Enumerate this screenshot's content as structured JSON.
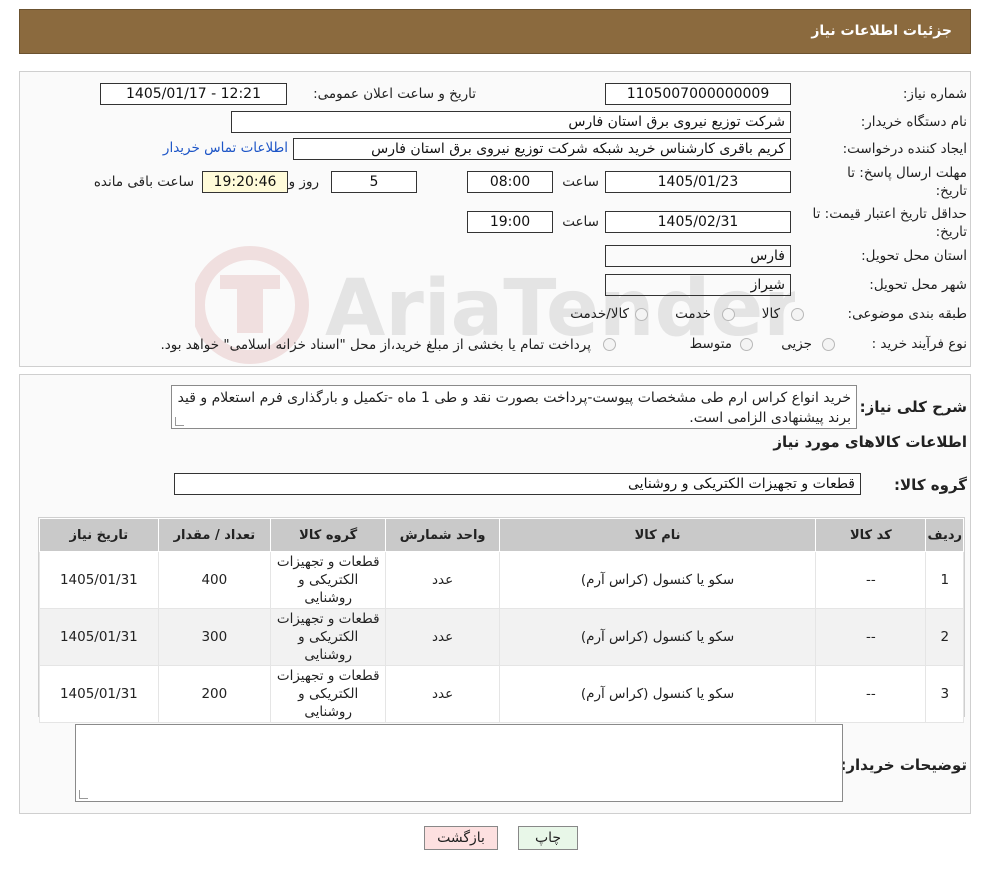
{
  "header": {
    "title": "جزئیات اطلاعات نیاز"
  },
  "form": {
    "need_number_label": "شماره نیاز:",
    "need_number": "1105007000000009",
    "announce_label": "تاریخ و ساعت اعلان عمومی:",
    "announce_value": "1405/01/17 - 12:21",
    "buyer_org_label": "نام دستگاه خریدار:",
    "buyer_org": "شرکت توزیع نیروی برق استان فارس",
    "creator_label": "ایجاد کننده درخواست:",
    "creator": "کریم باقری کارشناس خرید شبکه شرکت توزیع نیروی برق استان فارس",
    "contact_link": "اطلاعات تماس خریدار",
    "deadline_label_1": "مهلت ارسال پاسخ: تا",
    "deadline_label_2": "تاریخ:",
    "deadline_date": "1405/01/23",
    "time_label": "ساعت",
    "deadline_time": "08:00",
    "days_value": "5",
    "days_label": "روز و",
    "remaining_time": "19:20:46",
    "remaining_label": "ساعت باقی مانده",
    "validity_label_1": "حداقل تاریخ اعتبار قیمت: تا",
    "validity_label_2": "تاریخ:",
    "validity_date": "1405/02/31",
    "validity_time": "19:00",
    "province_label": "استان محل تحویل:",
    "province": "فارس",
    "city_label": "شهر محل تحویل:",
    "city": "شیراز",
    "category_label": "طبقه بندی موضوعی:",
    "category_options": [
      "کالا",
      "خدمت",
      "کالا/خدمت"
    ],
    "process_label": "نوع فرآیند خرید :",
    "process_options": [
      "جزیی",
      "متوسط"
    ],
    "process_note": "پرداخت تمام یا بخشی از مبلغ خرید،از محل \"اسناد خزانه اسلامی\" خواهد بود."
  },
  "watermark": {
    "text": "AriaTender.neT"
  },
  "description": {
    "label": "شرح کلی نیاز:",
    "text": "خرید انواع کراس ارم طی مشخصات پیوست-پرداخت بصورت نقد و طی 1 ماه -تکمیل و بارگذاری فرم استعلام و قید برند پیشنهادی الزامی است."
  },
  "goods_section": {
    "title": "اطلاعات کالاهای مورد نیاز",
    "group_label": "گروه کالا:",
    "group_value": "قطعات و تجهیزات الکتریکی و روشنایی"
  },
  "table": {
    "headers": [
      "ردیف",
      "کد کالا",
      "نام کالا",
      "واحد شمارش",
      "گروه کالا",
      "تعداد / مقدار",
      "تاریخ نیاز"
    ],
    "rows": [
      {
        "index": "1",
        "code": "--",
        "name": "سکو یا کنسول (کراس آرم)",
        "unit": "عدد",
        "group": [
          "قطعات و تجهیزات",
          "الکتریکی و",
          "روشنایی"
        ],
        "qty": "400",
        "date": "1405/01/31"
      },
      {
        "index": "2",
        "code": "--",
        "name": "سکو یا کنسول (کراس آرم)",
        "unit": "عدد",
        "group": [
          "قطعات و تجهیزات",
          "الکتریکی و",
          "روشنایی"
        ],
        "qty": "300",
        "date": "1405/01/31"
      },
      {
        "index": "3",
        "code": "--",
        "name": "سکو یا کنسول (کراس آرم)",
        "unit": "عدد",
        "group": [
          "قطعات و تجهیزات",
          "الکتریکی و",
          "روشنایی"
        ],
        "qty": "200",
        "date": "1405/01/31"
      }
    ]
  },
  "buyer_notes": {
    "label": "توضیحات خریدار:",
    "value": ""
  },
  "buttons": {
    "print": "چاپ",
    "back": "بازگشت"
  },
  "colors": {
    "header": "#8b6a3e",
    "back_button": "#fde0e0",
    "print_button": "#e8f7e8",
    "link": "#1d55c7",
    "remaining_bg": "#fffbd9"
  }
}
